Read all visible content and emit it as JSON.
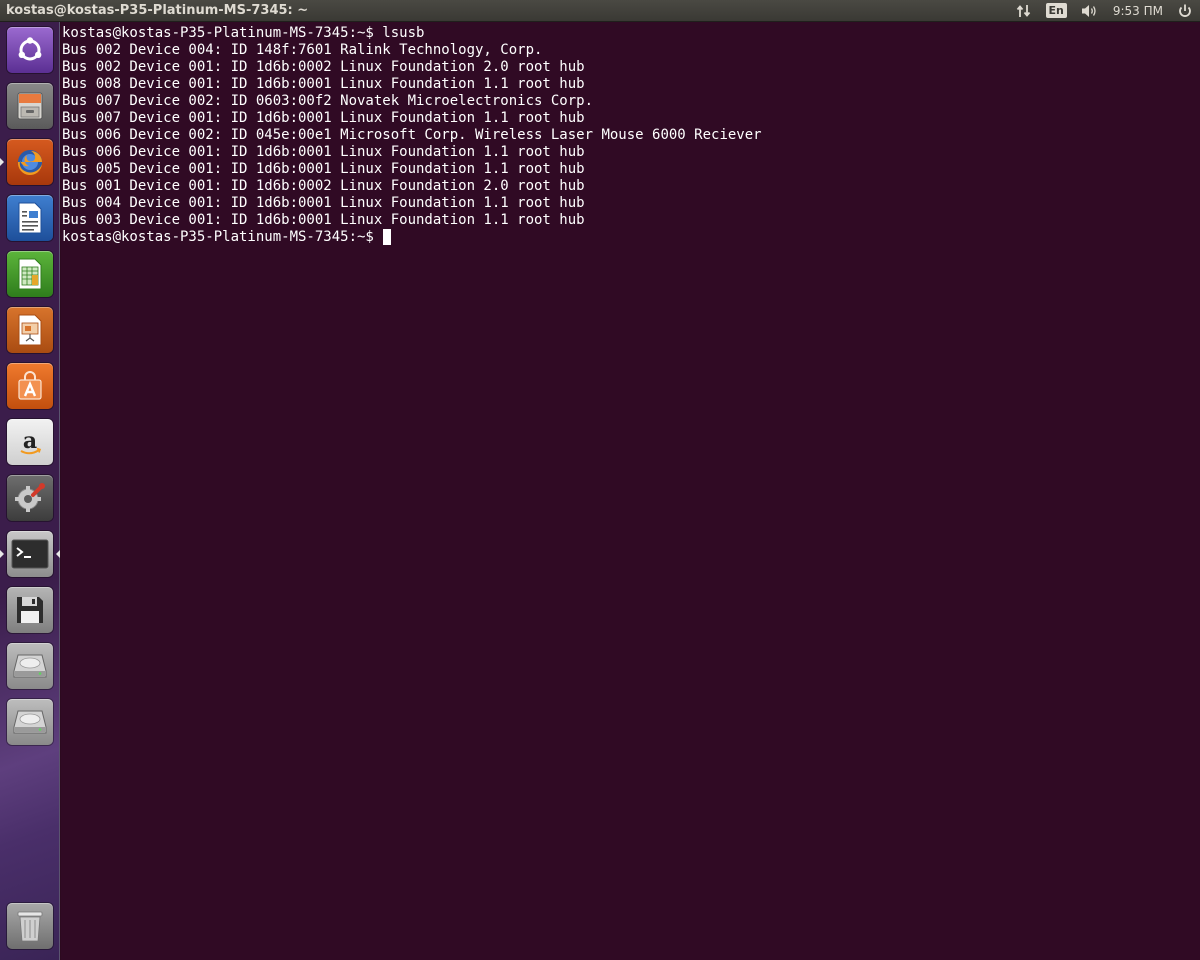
{
  "top_panel": {
    "window_title": "kostas@kostas-P35-Platinum-MS-7345: ~",
    "network_icon": "network-updown-icon",
    "keyboard_layout": "En",
    "volume_icon": "volume-icon",
    "clock": "9:53 ПМ",
    "power_icon": "power-icon"
  },
  "launcher": {
    "items": [
      {
        "name": "dash-home",
        "icon": "ubuntu-logo-icon"
      },
      {
        "name": "files",
        "icon": "file-cabinet-icon"
      },
      {
        "name": "firefox",
        "icon": "firefox-icon"
      },
      {
        "name": "libreoffice-writer",
        "icon": "writer-document-icon"
      },
      {
        "name": "libreoffice-calc",
        "icon": "calc-spreadsheet-icon"
      },
      {
        "name": "libreoffice-impress",
        "icon": "impress-presentation-icon"
      },
      {
        "name": "software-center",
        "icon": "shopping-bag-icon"
      },
      {
        "name": "amazon",
        "icon": "amazon-icon"
      },
      {
        "name": "system-settings",
        "icon": "settings-wrench-icon"
      },
      {
        "name": "terminal",
        "icon": "terminal-icon"
      },
      {
        "name": "save-device",
        "icon": "floppy-icon"
      },
      {
        "name": "drive-1",
        "icon": "hard-drive-icon"
      },
      {
        "name": "drive-2",
        "icon": "hard-drive-icon"
      },
      {
        "name": "trash",
        "icon": "trash-icon"
      }
    ]
  },
  "terminal": {
    "lines": [
      "kostas@kostas-P35-Platinum-MS-7345:~$ lsusb",
      "Bus 002 Device 004: ID 148f:7601 Ralink Technology, Corp.",
      "Bus 002 Device 001: ID 1d6b:0002 Linux Foundation 2.0 root hub",
      "Bus 008 Device 001: ID 1d6b:0001 Linux Foundation 1.1 root hub",
      "Bus 007 Device 002: ID 0603:00f2 Novatek Microelectronics Corp.",
      "Bus 007 Device 001: ID 1d6b:0001 Linux Foundation 1.1 root hub",
      "Bus 006 Device 002: ID 045e:00e1 Microsoft Corp. Wireless Laser Mouse 6000 Reciever",
      "Bus 006 Device 001: ID 1d6b:0001 Linux Foundation 1.1 root hub",
      "Bus 005 Device 001: ID 1d6b:0001 Linux Foundation 1.1 root hub",
      "Bus 001 Device 001: ID 1d6b:0002 Linux Foundation 2.0 root hub",
      "Bus 004 Device 001: ID 1d6b:0001 Linux Foundation 1.1 root hub",
      "Bus 003 Device 001: ID 1d6b:0001 Linux Foundation 1.1 root hub"
    ],
    "prompt": "kostas@kostas-P35-Platinum-MS-7345:~$ "
  },
  "colors": {
    "terminal_bg": "#300a24",
    "panel_bg": "#3c3b37",
    "text": "#ffffff"
  }
}
